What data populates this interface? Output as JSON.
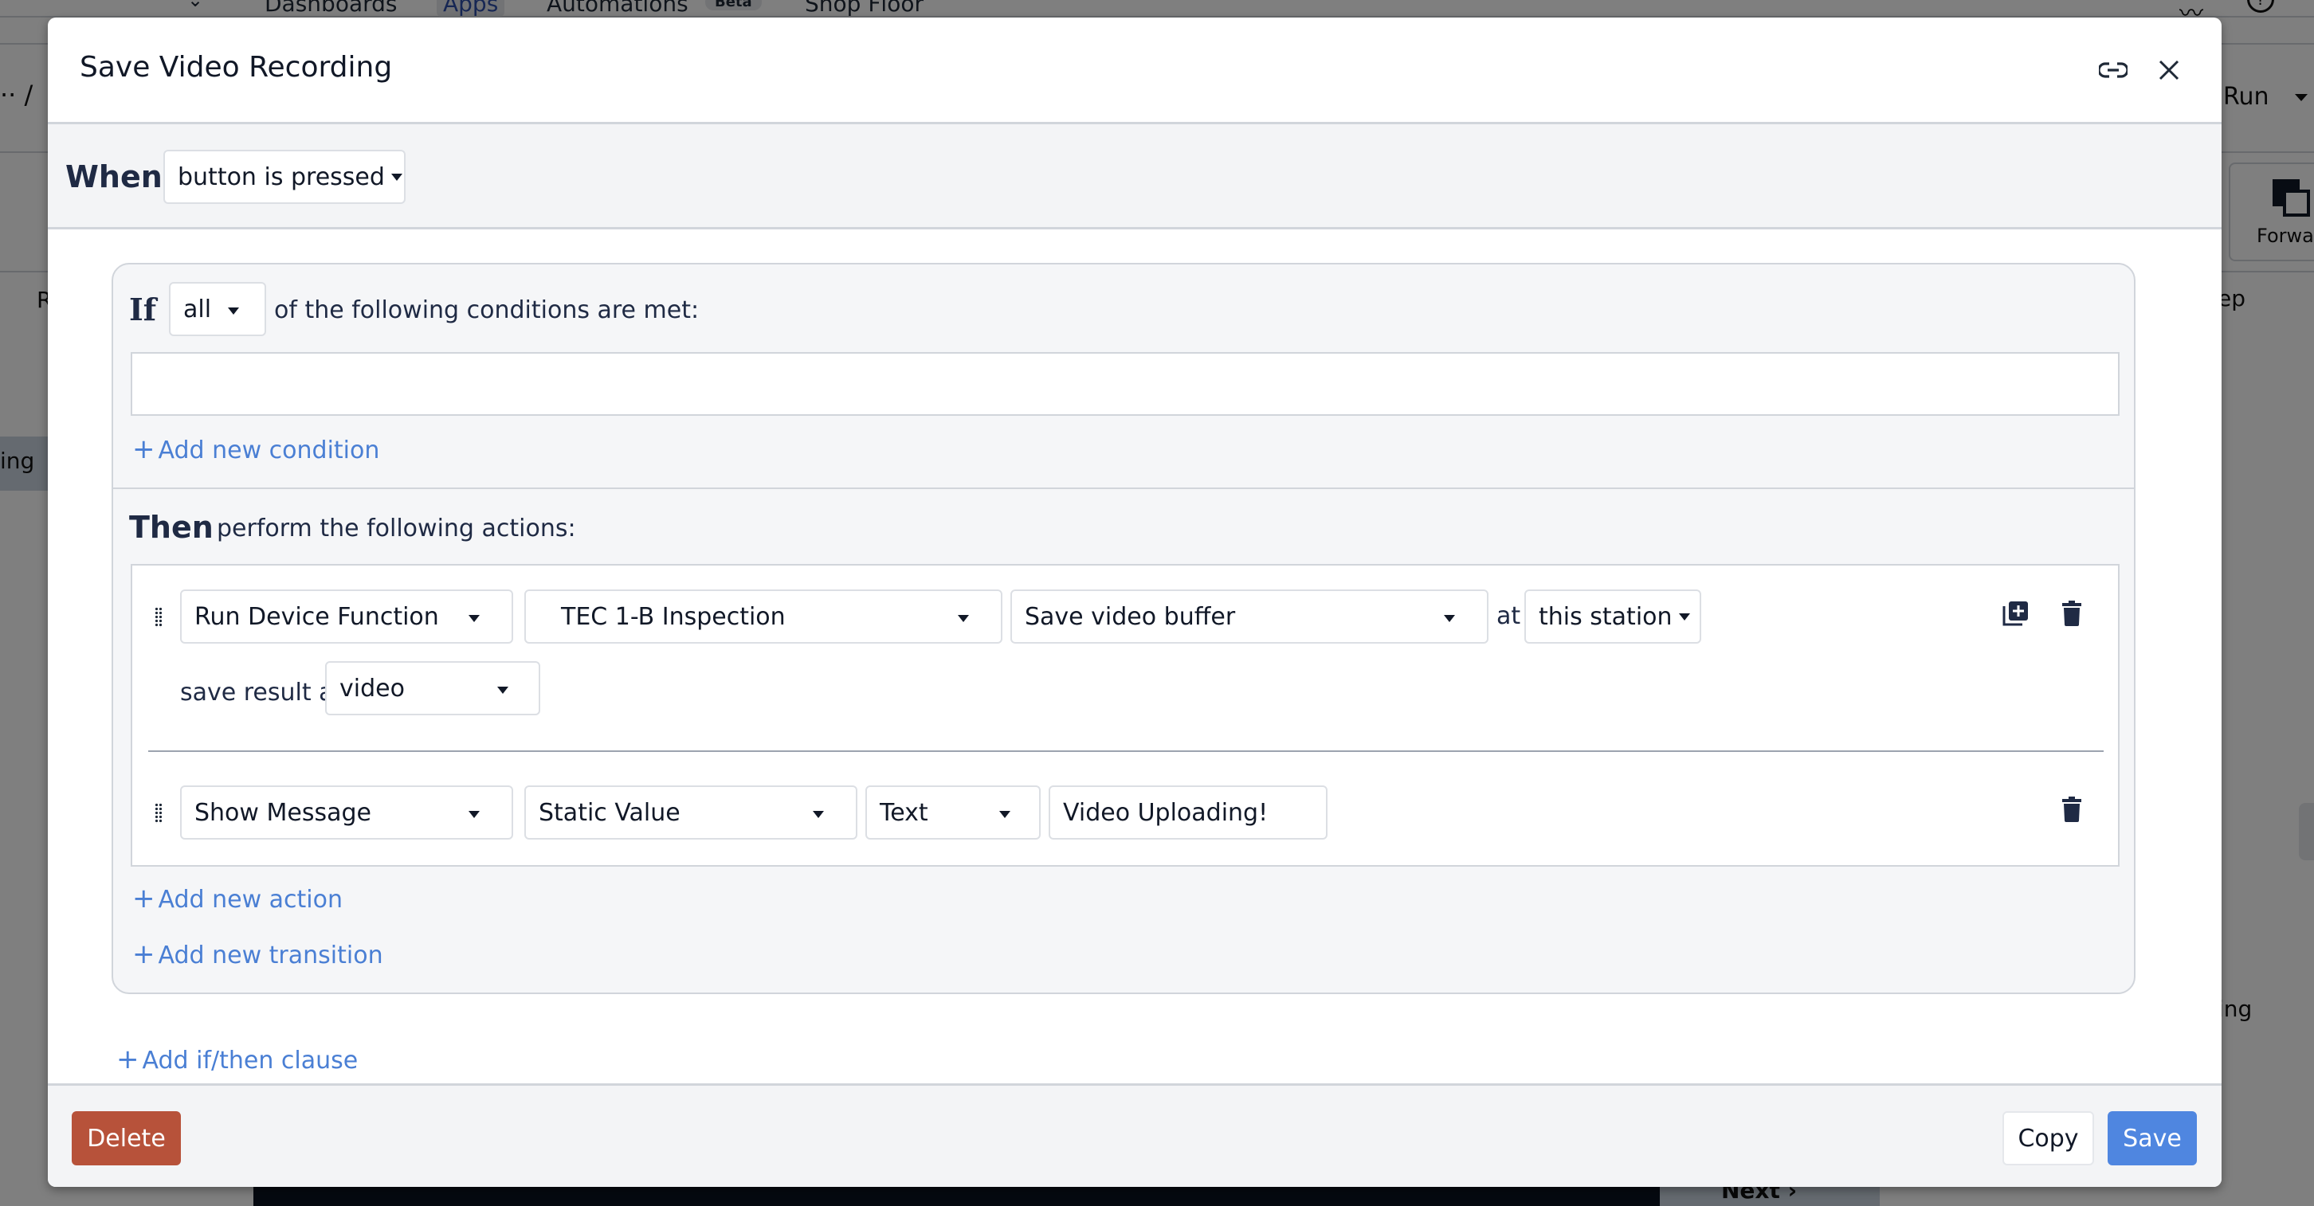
{
  "background": {
    "nav_tabs": [
      {
        "label": "Dashboards",
        "active": false
      },
      {
        "label": "Apps",
        "active": true
      },
      {
        "label": "Automations",
        "active": false
      },
      {
        "label": "Shop Floor",
        "active": false
      }
    ],
    "beta_badge": "Beta",
    "breadcrumb_fragment": "·· /",
    "run_label": "Run",
    "forward_label": "Forwar",
    "step_fragment": "ep",
    "left_fragment_r": "R",
    "left_fragment_ing": "ing",
    "right_fragment_ing": "ing",
    "next_label": "Next ›"
  },
  "modal": {
    "title": "Save Video Recording",
    "when": {
      "label": "When",
      "trigger": "button is pressed"
    },
    "clause": {
      "if_label": "If",
      "match_mode": "all",
      "if_text": "of the following conditions are met:",
      "add_condition": "Add new condition",
      "then_label": "Then",
      "then_text": "perform the following actions:",
      "actions": [
        {
          "type": "Run Device Function",
          "device": "TEC 1-B Inspection",
          "function": "Save video buffer",
          "at_label": "at",
          "location": "this station",
          "save_result_label": "save result as",
          "save_result_var": "video"
        },
        {
          "type": "Show Message",
          "source": "Static Value",
          "data_type": "Text",
          "value": "Video Uploading!"
        }
      ],
      "add_action": "Add new action",
      "add_transition": "Add new transition"
    },
    "add_clause": "Add if/then clause",
    "footer": {
      "delete": "Delete",
      "copy": "Copy",
      "save": "Save"
    }
  },
  "colors": {
    "link": "#4a7fd4",
    "primary": "#4f86e0",
    "danger": "#b7523a"
  }
}
